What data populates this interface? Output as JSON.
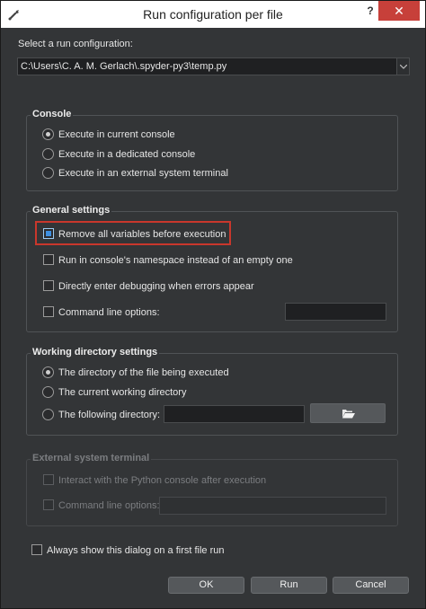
{
  "window": {
    "title": "Run configuration per file",
    "help_label": "?",
    "close_label": "✕"
  },
  "select_label": "Select a run configuration:",
  "config_path": "C:\\Users\\C. A. M. Gerlach\\.spyder-py3\\temp.py",
  "console": {
    "title": "Console",
    "options": [
      {
        "label": "Execute in current console",
        "checked": true
      },
      {
        "label": "Execute in a dedicated console",
        "checked": false
      },
      {
        "label": "Execute in an external system terminal",
        "checked": false
      }
    ]
  },
  "general": {
    "title": "General settings",
    "remove_vars": "Remove all variables before execution",
    "namespace": "Run in console's namespace instead of an empty one",
    "debugging": "Directly enter debugging when errors appear",
    "cmdline": "Command line options:",
    "cmdline_value": ""
  },
  "workdir": {
    "title": "Working directory settings",
    "options": [
      {
        "label": "The directory of the file being executed",
        "checked": true
      },
      {
        "label": "The current working directory",
        "checked": false
      },
      {
        "label": "The following directory:",
        "checked": false
      }
    ],
    "directory_value": ""
  },
  "external": {
    "title": "External system terminal",
    "interact": "Interact with the Python console after execution",
    "cmdline": "Command line options:",
    "cmdline_value": ""
  },
  "always_show": "Always show this dialog on a first file run",
  "buttons": {
    "ok": "OK",
    "run": "Run",
    "cancel": "Cancel"
  },
  "colors": {
    "highlight_border": "#c9372c",
    "close_button": "#c7403a",
    "check_accent": "#3d8fe0"
  },
  "icons": [
    "spyder-wrench-icon",
    "chevron-down-icon",
    "folder-open-icon"
  ]
}
